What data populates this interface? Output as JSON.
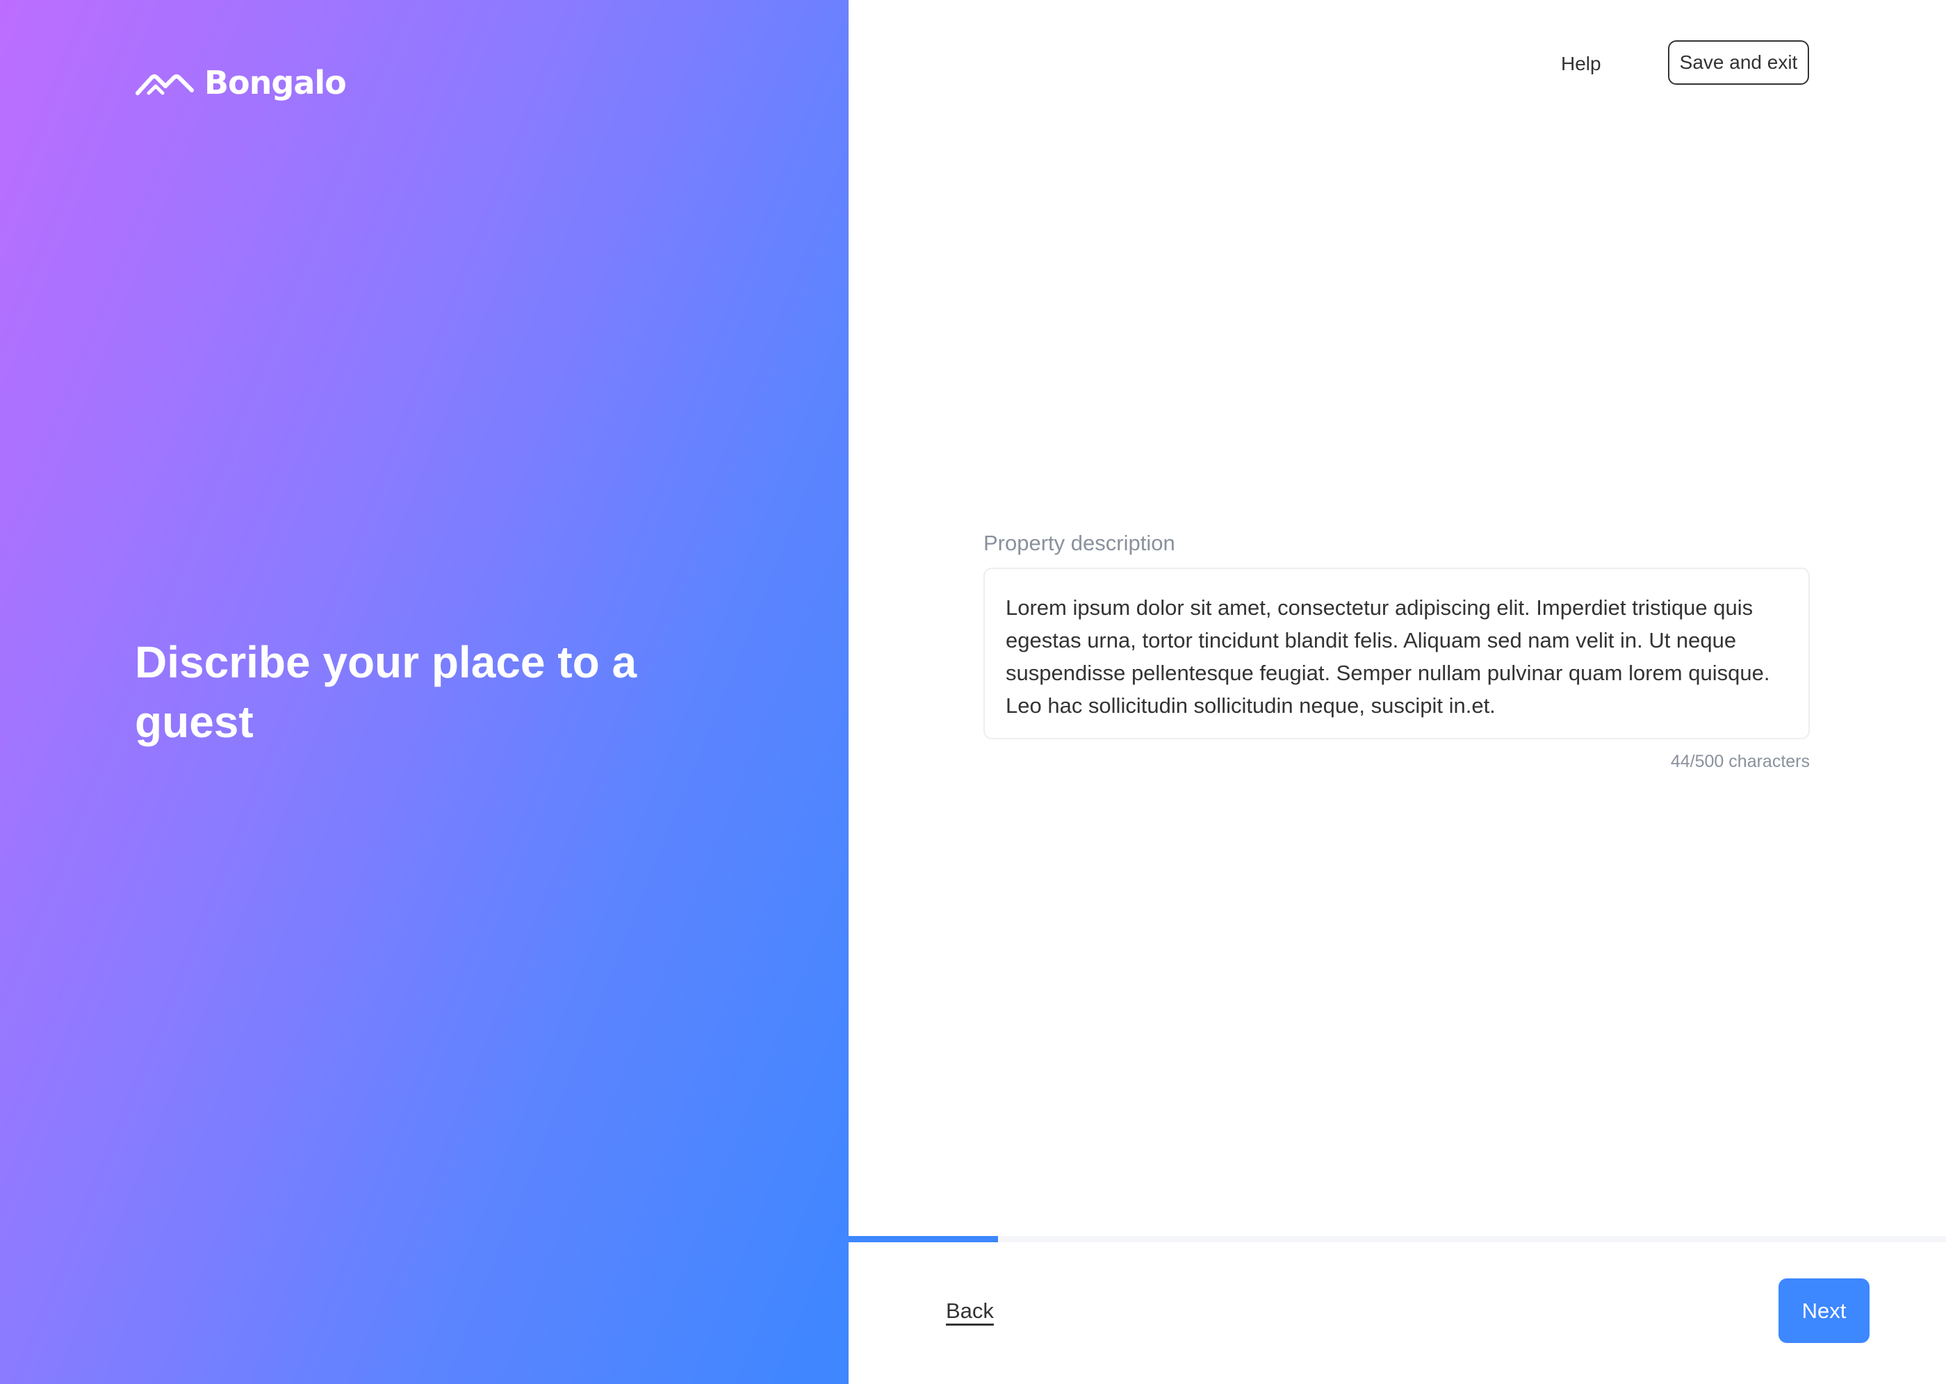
{
  "brand": {
    "name": "Bongalo",
    "logo_icon": "roof-arrow-logo-icon"
  },
  "hero": {
    "headline": "Discribe your place to a guest"
  },
  "header": {
    "help_label": "Help",
    "save_exit_label": "Save and exit"
  },
  "form": {
    "description_label": "Property description",
    "description_value": "Lorem ipsum dolor sit amet, consectetur adipiscing elit. Imperdiet tristique quis egestas urna, tortor tincidunt blandit felis. Aliquam sed nam velit in. Ut neque suspendisse pellentesque feugiat. Semper nullam pulvinar quam lorem quisque. Leo hac sollicitudin sollicitudin neque, suscipit in.et.",
    "char_count": "44/500 characters"
  },
  "footer": {
    "progress_fraction": 0.136,
    "back_label": "Back",
    "next_label": "Next"
  },
  "colors": {
    "accent": "#3d87ff",
    "gradient_start": "#bd6dff",
    "gradient_end": "#3d87ff",
    "text_dark": "#333333",
    "text_muted": "#8a919c"
  }
}
